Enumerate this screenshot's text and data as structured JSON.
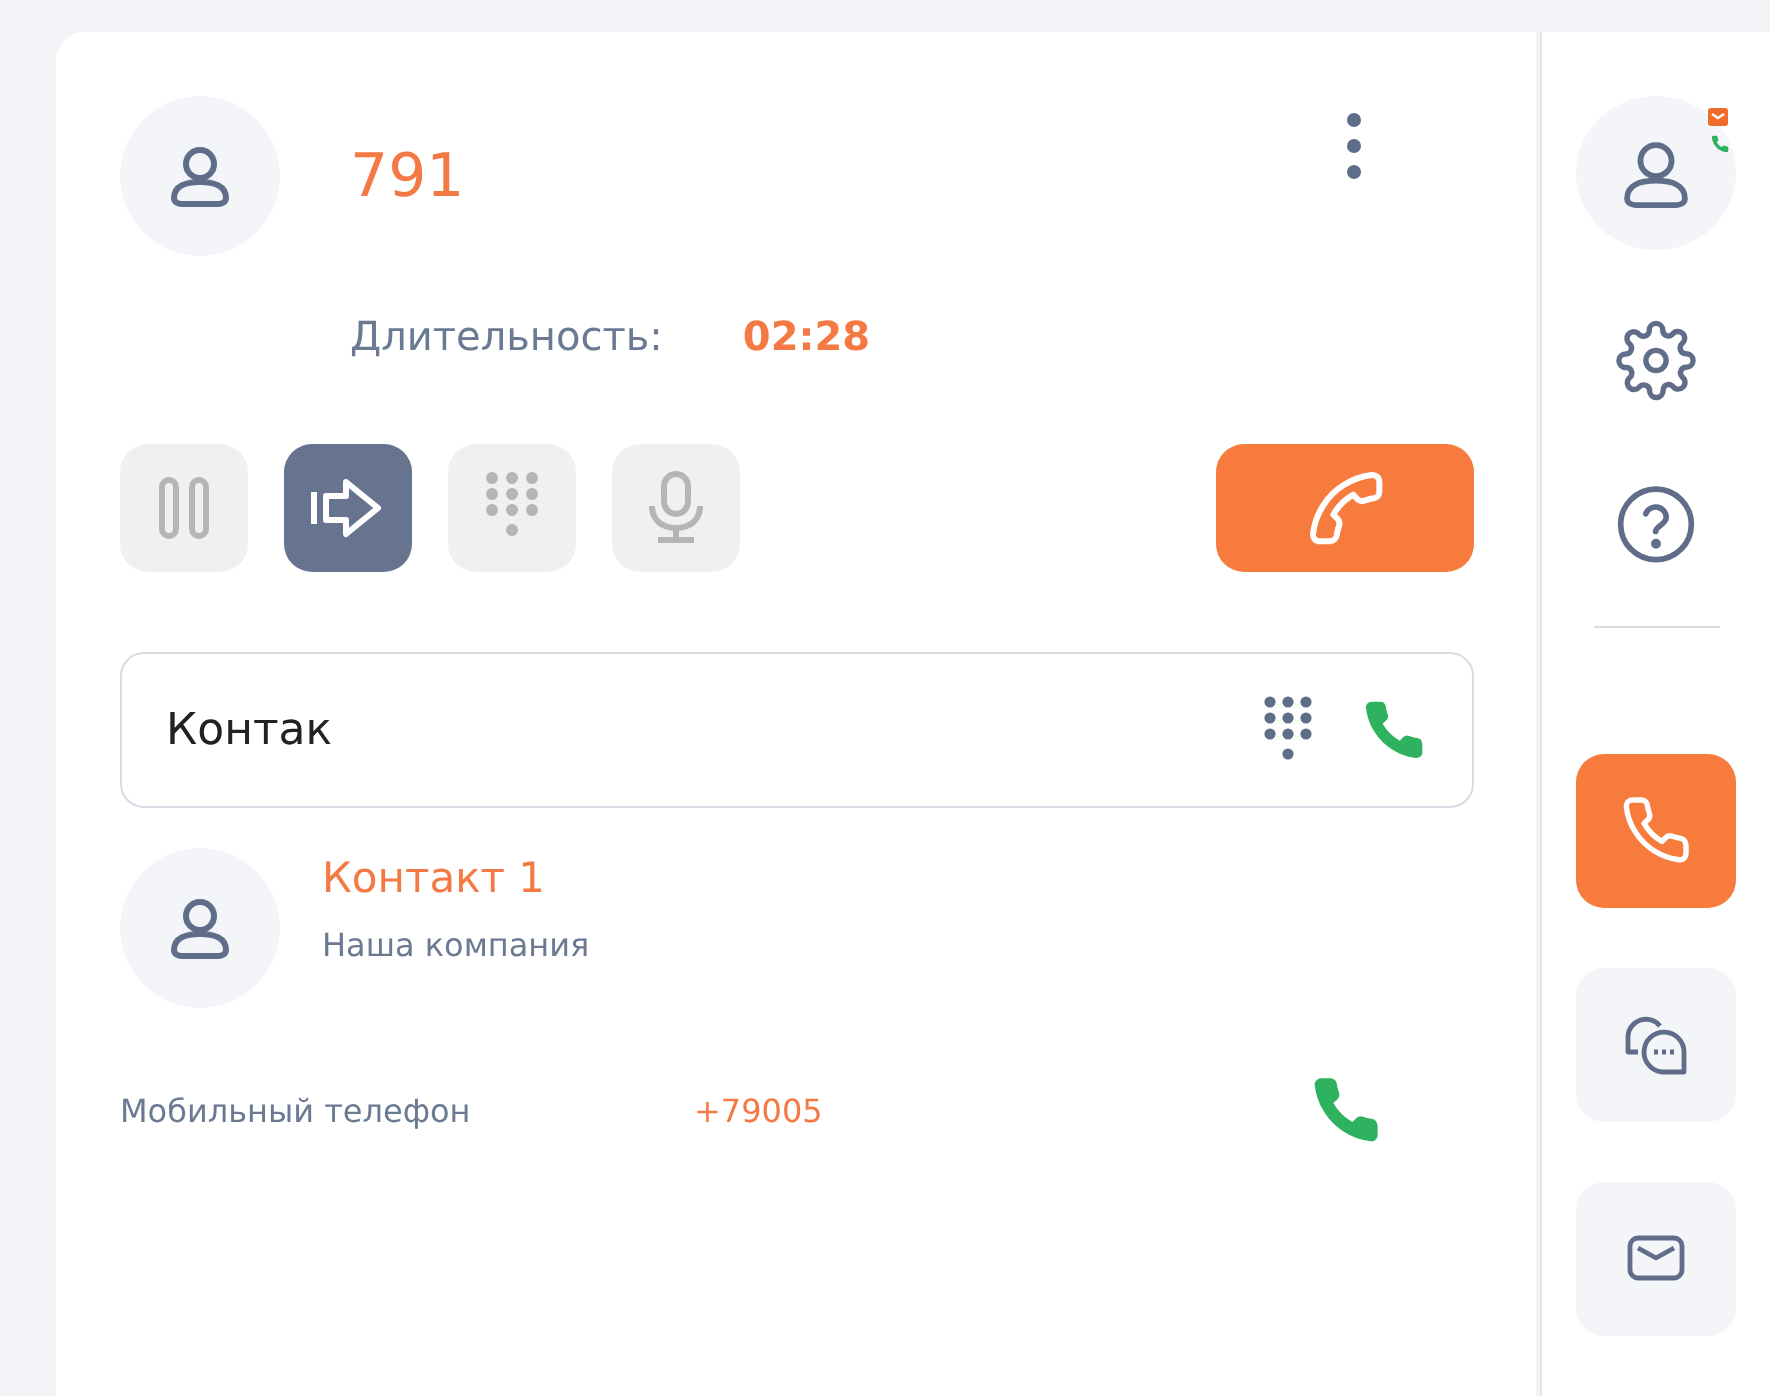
{
  "call": {
    "number": "791",
    "duration_label": "Длительность:",
    "duration": "02:28"
  },
  "controls": [
    {
      "kind": "hold",
      "active": false
    },
    {
      "kind": "transfer",
      "active": true
    },
    {
      "kind": "keypad",
      "active": false
    },
    {
      "kind": "mute",
      "active": false
    }
  ],
  "search": {
    "value": "Контак"
  },
  "contact": {
    "name": "Контакт 1",
    "company": "Наша компания",
    "phone_label": "Мобильный телефон",
    "phone": "+79005"
  },
  "rail": {
    "status": {
      "missed_mail": true,
      "on_call": true
    },
    "tabs": [
      {
        "kind": "phone",
        "selected": true
      },
      {
        "kind": "chat",
        "selected": false
      },
      {
        "kind": "mail",
        "selected": false
      }
    ]
  }
}
